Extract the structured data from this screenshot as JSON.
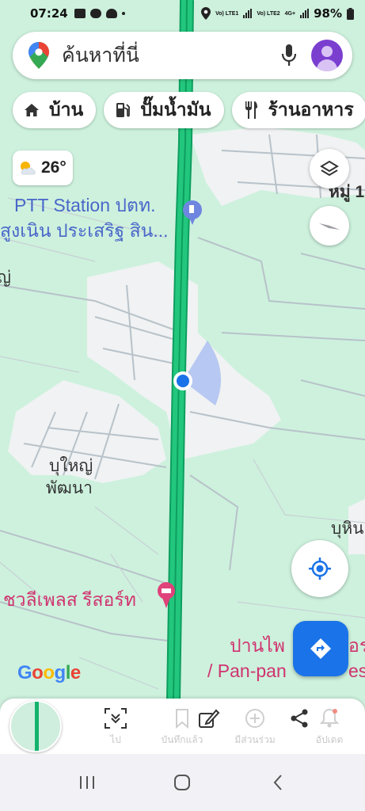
{
  "status_bar": {
    "time": "07:24",
    "sim1_label": "Vo) LTE1",
    "sim2_label": "Vo) LTE2",
    "network": "4G+",
    "battery": "98%"
  },
  "search": {
    "placeholder": "ค้นหาที่นี่"
  },
  "chips": [
    {
      "label": "บ้าน",
      "icon": "home-icon"
    },
    {
      "label": "ปั๊มน้ำมัน",
      "icon": "gas-station-icon"
    },
    {
      "label": "ร้านอาหาร",
      "icon": "restaurant-icon"
    }
  ],
  "weather": {
    "temperature": "26°",
    "icon": "partly-cloudy-icon"
  },
  "map": {
    "poi_ptt_line1": "PTT Station ปตท.",
    "poi_ptt_line2": "สูงเนิน ประเสริฐ สิน...",
    "area_moo": "หมู่ 1",
    "area_bu_yai_1": "บุใหญ่",
    "area_bu_yai_2": "พัฒนา",
    "area_bu_hin": "บุหิน",
    "area_left_edge": "ญ่",
    "poi_resort": "ชวลีเพลส รีสอร์ท",
    "poi_pan_1": "ปานไพ",
    "poi_pan_1b": "อร",
    "poi_pan_2": "/ Pan-pan",
    "poi_pan_2b": "esor",
    "google": [
      "G",
      "o",
      "o",
      "g",
      "l",
      "e"
    ],
    "colors": {
      "road_highway": "#12b36c",
      "water_green": "#cdf1dd",
      "location_dot": "#1a73e8",
      "poi_blue": "#4a67c9",
      "poi_pink": "#d0336f"
    }
  },
  "bottom_actions": [
    {
      "label": "ไป",
      "icon": "latest-icon"
    },
    {
      "label": "บันทึกแล้ว",
      "icon": "bookmark-icon"
    },
    {
      "label": "มีส่วนร่วม",
      "icon": "contribute-icon"
    },
    {
      "label": "",
      "icon": "share-icon"
    },
    {
      "label": "อัปเดต",
      "icon": "bell-icon"
    }
  ],
  "bottom_action_labels": {
    "go": "ไป",
    "saved": "บันทึกแล้ว",
    "contribute": "มีส่วนร่วม",
    "updates": "อัปเดต"
  },
  "navbar": [
    "recent-apps-icon",
    "home-button-icon",
    "back-icon"
  ]
}
